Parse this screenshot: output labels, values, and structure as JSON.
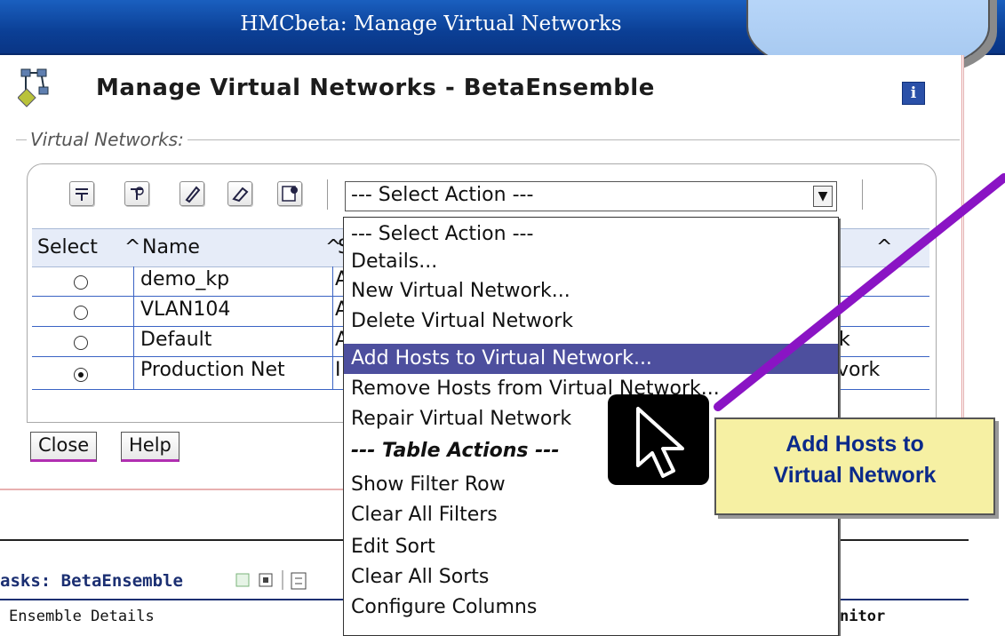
{
  "window": {
    "title": "HMCbeta: Manage Virtual Networks"
  },
  "heading": "Manage Virtual Networks - BetaEnsemble",
  "info_button": "i",
  "group_legend": "Virtual Networks:",
  "toolbar": {
    "icons": [
      "select-all-icon",
      "deselect-all-icon",
      "edit-icon",
      "clear-icon",
      "configure-columns-icon"
    ]
  },
  "select_action": {
    "value": "--- Select Action ---"
  },
  "table": {
    "columns": [
      "Select",
      "Name",
      "S"
    ],
    "sort_glyph": "^",
    "rows": [
      {
        "name": "demo_kp",
        "col3": "A",
        "selected": false,
        "tail": ""
      },
      {
        "name": "VLAN104",
        "col3": "A",
        "selected": false,
        "tail": ""
      },
      {
        "name": "Default",
        "col3": "A",
        "selected": false,
        "tail": "k"
      },
      {
        "name": "Production Net",
        "col3": "I",
        "selected": true,
        "tail": "vork"
      }
    ]
  },
  "buttons": {
    "close": "Close",
    "help": "Help"
  },
  "dropdown": {
    "items": [
      "--- Select Action ---",
      "Details...",
      "New Virtual Network...",
      "Delete Virtual Network",
      "Add Hosts to Virtual Network...",
      "Remove Hosts from Virtual Network...",
      "Repair Virtual Network",
      "--- Table Actions ---",
      "Show Filter Row",
      "Clear All Filters",
      "Edit Sort",
      "Clear All Sorts",
      "Configure Columns"
    ],
    "highlighted_index": 4,
    "section_header_index": 7
  },
  "tasks": {
    "label": "asks: BetaEnsemble",
    "item": "Ensemble Details",
    "right_item": "nitor"
  },
  "callout": {
    "line1": "Add Hosts to",
    "line2": "Virtual Network"
  },
  "colors": {
    "titlebar": "#0b3f95",
    "highlight": "#4d4f9e",
    "callout_bg": "#f6f0a3",
    "callout_text": "#0b2a8a",
    "arrow": "#8a14c4"
  }
}
